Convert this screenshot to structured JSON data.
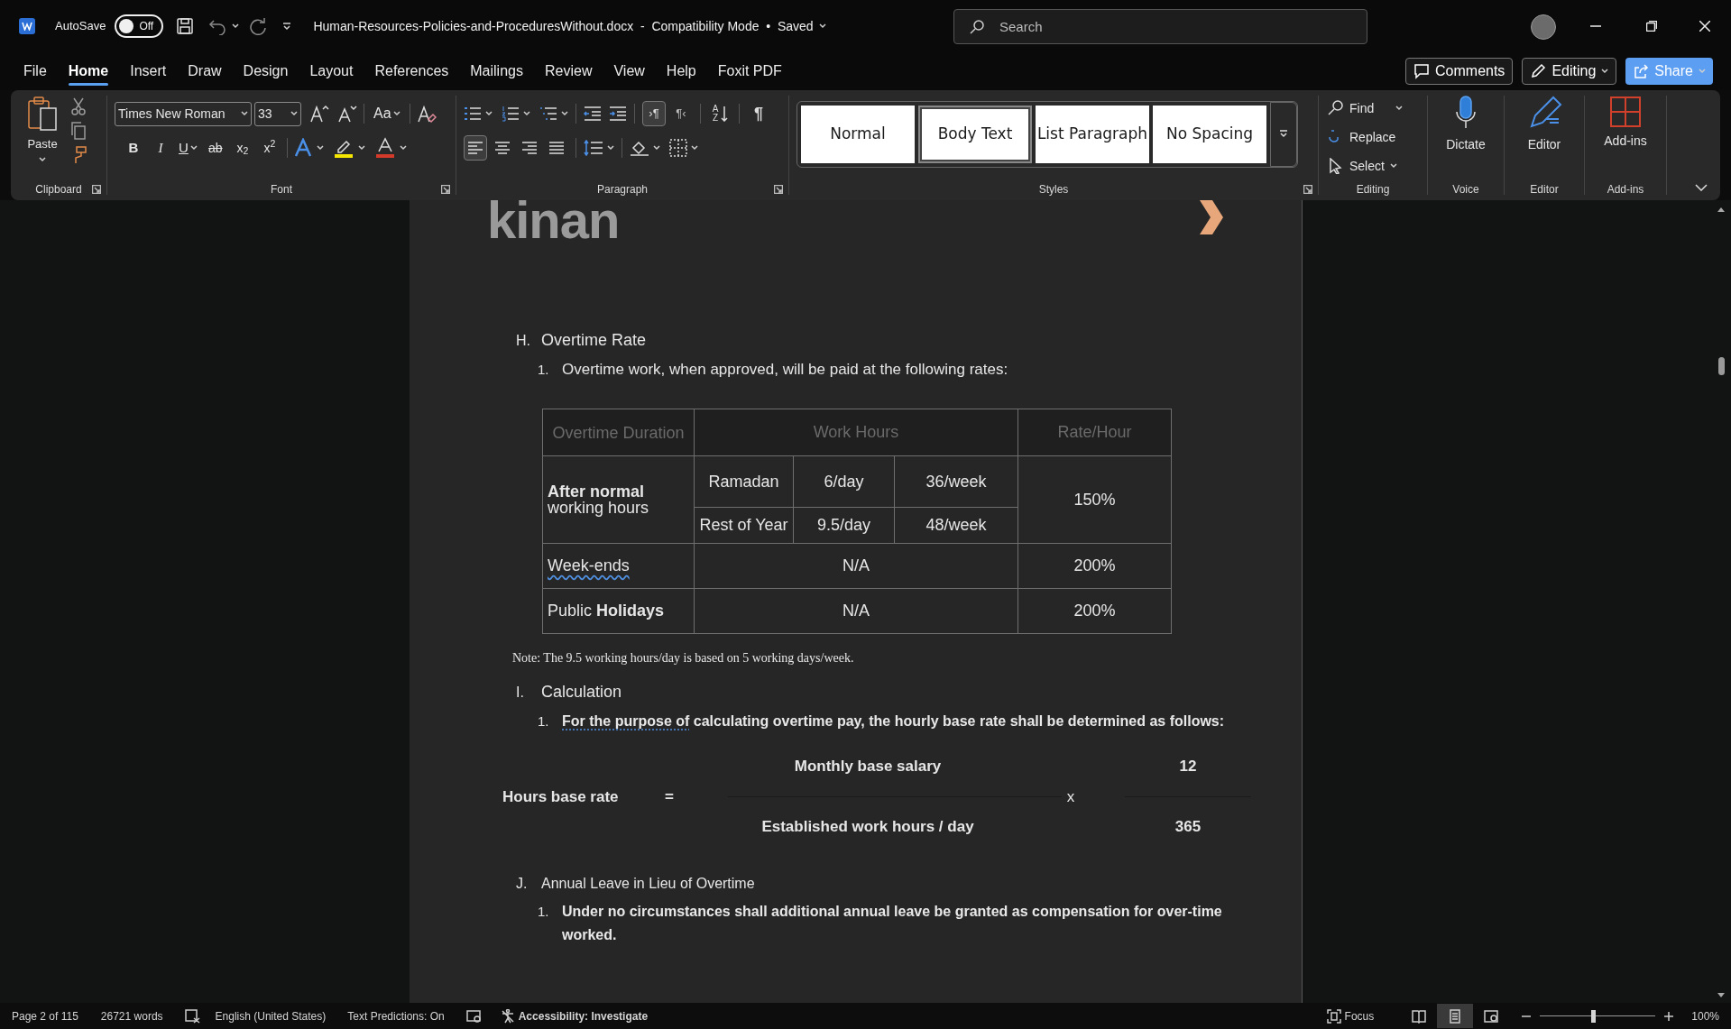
{
  "title_bar": {
    "autosave_label": "AutoSave",
    "autosave": {
      "label": "Off",
      "on": false
    },
    "document_title": "Human-Resources-Policies-and-ProceduresWithout.docx  -  Compatibility Mode  •  Saved",
    "search": {
      "placeholder": "Search"
    }
  },
  "menu_tabs": [
    {
      "label": "File",
      "selected": false
    },
    {
      "label": "Home",
      "selected": true
    },
    {
      "label": "Insert",
      "selected": false
    },
    {
      "label": "Draw",
      "selected": false
    },
    {
      "label": "Design",
      "selected": false
    },
    {
      "label": "Layout",
      "selected": false
    },
    {
      "label": "References",
      "selected": false
    },
    {
      "label": "Mailings",
      "selected": false
    },
    {
      "label": "Review",
      "selected": false
    },
    {
      "label": "View",
      "selected": false
    },
    {
      "label": "Help",
      "selected": false
    },
    {
      "label": "Foxit PDF",
      "selected": false
    }
  ],
  "top_buttons": [
    {
      "kind": "comments",
      "label": "Comments"
    },
    {
      "kind": "editing",
      "label": "Editing"
    },
    {
      "kind": "share",
      "label": "Share"
    }
  ],
  "ribbon": {
    "clipboard": {
      "paste": "Paste",
      "group": "Clipboard"
    },
    "font": {
      "name": "Times New Roman",
      "size": "33",
      "case": "Aa",
      "bold": "B",
      "italic": "I",
      "underline": "U",
      "strike": "ab",
      "subscript": "x$_{2}$",
      "superscript": "x$^{2}$",
      "group": "Font"
    },
    "paragraph": {
      "alignment": [
        {
          "kind": "left",
          "selected": true
        },
        {
          "kind": "center",
          "selected": false
        },
        {
          "kind": "right",
          "selected": false
        },
        {
          "kind": "justify",
          "selected": false
        }
      ],
      "direction": [
        {
          "kind": "ltr",
          "glyph": "›¶",
          "selected": true
        },
        {
          "kind": "rtl",
          "glyph": "¶‹",
          "selected": false
        }
      ],
      "sort": "AZ",
      "show_marks": "¶",
      "group": "Paragraph"
    },
    "styles": {
      "items": [
        {
          "label": "Normal",
          "selected": false
        },
        {
          "label": "Body Text",
          "selected": true
        },
        {
          "label": "List Paragraph",
          "selected": false
        },
        {
          "label": "No Spacing",
          "selected": false
        }
      ],
      "group": "Styles"
    },
    "editing": {
      "items": [
        {
          "kind": "find",
          "label": "Find"
        },
        {
          "kind": "replace",
          "label": "Replace"
        },
        {
          "kind": "select",
          "label": "Select"
        }
      ],
      "group": "Editing"
    },
    "voice": {
      "label": "Dictate",
      "group": "Voice"
    },
    "editor": {
      "label": "Editor",
      "group": "Editor"
    },
    "addins": {
      "label": "Add-ins",
      "group": "Add-ins"
    }
  },
  "document": {
    "logo": "kinan",
    "section_h": {
      "marker": "H.",
      "title": "Overtime Rate",
      "items": [
        {
          "marker": "1.",
          "text": "Overtime work, when approved, will be paid at the following rates:"
        }
      ]
    },
    "rates_table": {
      "columns": [
        "Overtime Duration",
        "Work Hours",
        "Rate/Hour"
      ],
      "overtime_row": {
        "label": "**After normal** working hours",
        "periods": [
          {
            "name": "Ramadan",
            "daily": "6/day",
            "weekly": "36/week"
          },
          {
            "name": "Rest of Year",
            "daily": "9.5/day",
            "weekly": "48/week"
          }
        ],
        "rate": "150%"
      },
      "other_rows": [
        {
          "label": "Week-ends",
          "flagged": true,
          "hours": "N/A",
          "rate": "200%"
        },
        {
          "label": "Public **Holidays**",
          "flagged": false,
          "hours": "N/A",
          "rate": "200%"
        }
      ]
    },
    "note": "Note: The 9.5 working hours/day is based on 5 working days/week.",
    "section_i": {
      "marker": "I.",
      "title": "Calculation",
      "items": [
        {
          "marker": "1.",
          "flagged_part": "For the purpose of",
          "text": " calculating overtime pay, the hourly base rate shall be determined as follows:"
        }
      ]
    },
    "formula": {
      "label": "Hours base rate",
      "equals": "=",
      "numerator": "Monthly base salary",
      "denominator": "Established work hours / day",
      "times": "x",
      "factor_numerator": "12",
      "factor_denominator": "365"
    },
    "section_j": {
      "marker": "J.",
      "title": "Annual Leave in Lieu of Overtime",
      "items": [
        {
          "marker": "1.",
          "text": "Under no circumstances shall additional annual leave be granted as compensation for over-time worked."
        }
      ]
    }
  },
  "status_bar": {
    "page": "Page 2 of 115",
    "words": "26721 words",
    "language": "English (United States)",
    "predictions": "Text Predictions: On",
    "accessibility": "Accessibility: Investigate",
    "focus": "Focus",
    "views": [
      {
        "kind": "read",
        "selected": false
      },
      {
        "kind": "print",
        "selected": true
      },
      {
        "kind": "web",
        "selected": false
      }
    ],
    "zoom": {
      "level": 0.46,
      "reading": "100%"
    }
  }
}
